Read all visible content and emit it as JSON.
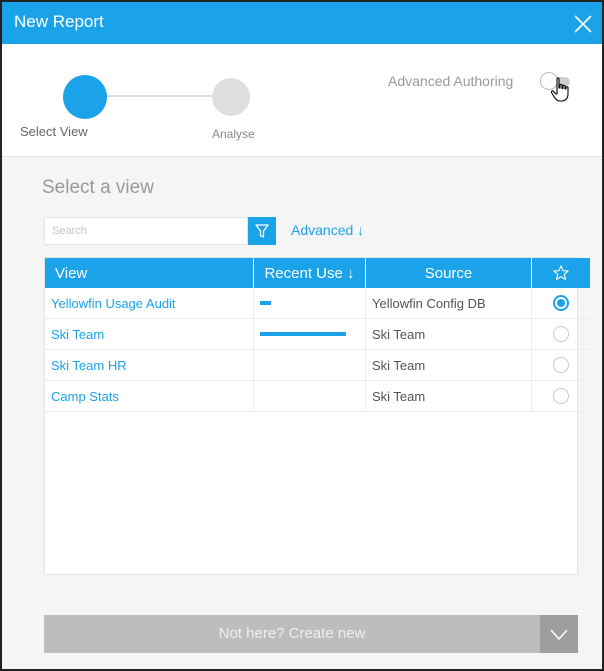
{
  "dialog": {
    "title": "New Report",
    "close_icon": "close-icon"
  },
  "wizard": {
    "steps": [
      {
        "label": "Select View",
        "active": true
      },
      {
        "label": "Analyse",
        "active": false
      }
    ],
    "advanced_authoring_label": "Advanced Authoring",
    "advanced_authoring_enabled": false
  },
  "content": {
    "section_title": "Select a view",
    "search": {
      "placeholder": "Search",
      "value": ""
    },
    "filter_icon": "filter-icon",
    "advanced_link": "Advanced ↓"
  },
  "table": {
    "headers": {
      "view": "View",
      "recent": "Recent Use ↓",
      "source": "Source",
      "favourite_icon": "star-icon"
    },
    "rows": [
      {
        "view": "Yellowfin Usage Audit",
        "recent_use": 0.13,
        "source": "Yellowfin Config DB",
        "selected": true
      },
      {
        "view": "Ski Team",
        "recent_use": 1.0,
        "source": "Ski Team",
        "selected": false
      },
      {
        "view": "Ski Team HR",
        "recent_use": 0,
        "source": "Ski Team",
        "selected": false
      },
      {
        "view": "Camp Stats",
        "recent_use": 0,
        "source": "Ski Team",
        "selected": false
      }
    ]
  },
  "create_new": {
    "label": "Not here? Create new",
    "dropdown_icon": "chevron-down-icon"
  },
  "colors": {
    "accent": "#1aa3e8",
    "disabled_button": "#bdbdbd"
  }
}
